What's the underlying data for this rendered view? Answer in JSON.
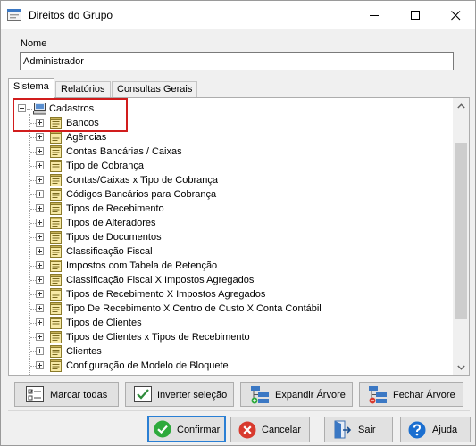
{
  "window": {
    "title": "Direitos do Grupo"
  },
  "form": {
    "name_label": "Nome",
    "name_value": "Administrador"
  },
  "tabs": [
    {
      "label": "Sistema",
      "active": true
    },
    {
      "label": "Relatórios",
      "active": false
    },
    {
      "label": "Consultas Gerais",
      "active": false
    }
  ],
  "tree": {
    "root": {
      "label": "Cadastros",
      "expanded": true,
      "icon": "computer-icon"
    },
    "items": [
      {
        "label": "Bancos"
      },
      {
        "label": "Agências"
      },
      {
        "label": "Contas Bancárias / Caixas"
      },
      {
        "label": "Tipo de Cobrança"
      },
      {
        "label": "Contas/Caixas x Tipo de Cobrança"
      },
      {
        "label": "Códigos Bancários para Cobrança"
      },
      {
        "label": "Tipos de Recebimento"
      },
      {
        "label": "Tipos de Alteradores"
      },
      {
        "label": "Tipos de Documentos"
      },
      {
        "label": "Classificação Fiscal"
      },
      {
        "label": "Impostos com Tabela de Retenção"
      },
      {
        "label": "Classificação Fiscal X Impostos Agregados"
      },
      {
        "label": "Tipos de Recebimento X Impostos Agregados"
      },
      {
        "label": "Tipo De Recebimento X Centro de Custo X Conta Contábil"
      },
      {
        "label": "Tipos de Clientes"
      },
      {
        "label": "Tipos de Clientes x Tipos de Recebimento"
      },
      {
        "label": "Clientes"
      },
      {
        "label": "Configuração de Modelo de Bloquete"
      }
    ],
    "item_icon": "notepad-icon",
    "highlight_color": "#d11d1d"
  },
  "actions": {
    "mark_all": "Marcar todas",
    "invert": "Inverter seleção",
    "expand": "Expandir Árvore",
    "collapse": "Fechar Árvore"
  },
  "footer": {
    "confirm": "Confirmar",
    "cancel": "Cancelar",
    "exit": "Sair",
    "help": "Ajuda"
  },
  "colors": {
    "confirm_green": "#2eaa3c",
    "cancel_red": "#d83a2e",
    "help_blue": "#1b6fd0",
    "default_border": "#2a7fd4"
  }
}
